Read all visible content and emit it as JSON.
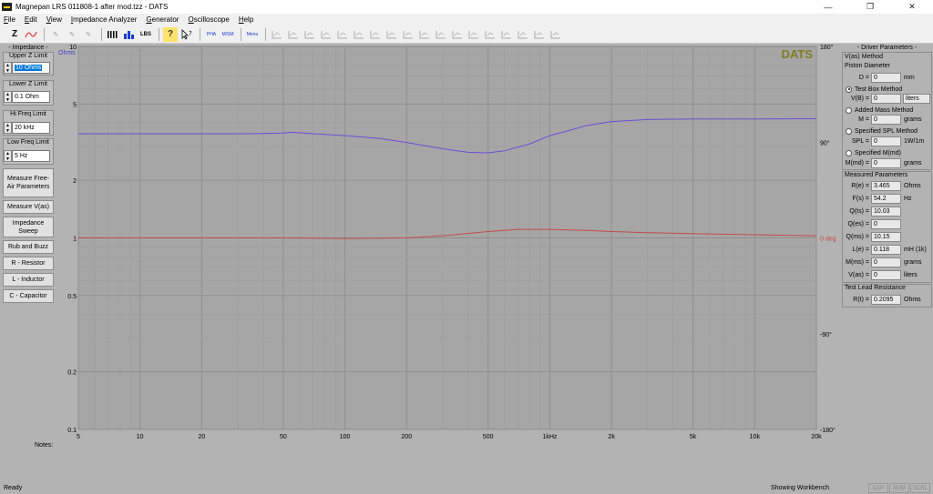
{
  "window": {
    "title": "Magnepan LRS 011808-1 after mod.tzz - DATS",
    "minimize": "—",
    "maximize": "❐",
    "close": "✕"
  },
  "menu": [
    {
      "label": "File",
      "key": "F"
    },
    {
      "label": "Edit",
      "key": "E"
    },
    {
      "label": "View",
      "key": "V"
    },
    {
      "label": "Impedance Analyzer",
      "key": "I"
    },
    {
      "label": "Generator",
      "key": "G"
    },
    {
      "label": "Oscilloscope",
      "key": "O"
    },
    {
      "label": "Help",
      "key": "H"
    }
  ],
  "toolbar": {
    "z_label": "Z",
    "help_label": "?",
    "lbs_label": "LBS",
    "pha_label": "PHA",
    "ms_label": "M/SM",
    "menu_label": "Menu"
  },
  "left_panel": {
    "section_title": "- Impedance -",
    "upper_label": "Upper Z Limit",
    "upper_value": "10 Ohms",
    "lower_label": "Lower Z Limit",
    "lower_value": "0.1 Ohm",
    "hi_label": "Hi Freq Limit",
    "hi_value": "20 kHz",
    "low_label": "Low Freq Limit",
    "low_value": "5 Hz",
    "buttons": [
      "Measure Free-Air Parameters",
      "Measure V(as)",
      "Impedance Sweep",
      "Rub and Buzz",
      "R - Resistor",
      "L - Inductor",
      "C - Capacitor"
    ]
  },
  "chart_data": {
    "type": "line",
    "watermark": "DATS",
    "y_unit": "Ohms",
    "x_scale": "log",
    "y_scale": "log",
    "xlim": [
      5,
      20000
    ],
    "ylim": [
      0.1,
      10
    ],
    "y2lim": [
      -180,
      180
    ],
    "x_tick_labels": [
      {
        "v": 5,
        "t": "5"
      },
      {
        "v": 10,
        "t": "10"
      },
      {
        "v": 20,
        "t": "20"
      },
      {
        "v": 50,
        "t": "50"
      },
      {
        "v": 100,
        "t": "100"
      },
      {
        "v": 200,
        "t": "200"
      },
      {
        "v": 500,
        "t": "500"
      },
      {
        "v": 1000,
        "t": "1kHz"
      },
      {
        "v": 2000,
        "t": "2k"
      },
      {
        "v": 5000,
        "t": "5k"
      },
      {
        "v": 10000,
        "t": "10k"
      },
      {
        "v": 20000,
        "t": "20k"
      }
    ],
    "y_tick_labels": [
      {
        "v": 10,
        "t": "10"
      },
      {
        "v": 5,
        "t": "5"
      },
      {
        "v": 2,
        "t": "2"
      },
      {
        "v": 1,
        "t": "1"
      },
      {
        "v": 0.5,
        "t": "0.5"
      },
      {
        "v": 0.2,
        "t": "0.2"
      },
      {
        "v": 0.1,
        "t": "0.1"
      }
    ],
    "y2_tick_labels": [
      {
        "v": 180,
        "t": "180°"
      },
      {
        "v": 90,
        "t": "90°"
      },
      {
        "v": 0,
        "t": "0 deg"
      },
      {
        "v": -90,
        "t": "-90°"
      },
      {
        "v": -180,
        "t": "-180°"
      }
    ],
    "grid": true,
    "series": [
      {
        "axis": "left",
        "color": "#6b4fd6",
        "x": [
          5,
          10,
          20,
          30,
          40,
          50,
          55,
          70,
          100,
          150,
          200,
          300,
          400,
          500,
          600,
          800,
          1000,
          1500,
          2000,
          3000,
          5000,
          10000,
          20000
        ],
        "y": [
          3.5,
          3.5,
          3.5,
          3.5,
          3.51,
          3.53,
          3.56,
          3.5,
          3.42,
          3.3,
          3.15,
          2.92,
          2.8,
          2.78,
          2.85,
          3.1,
          3.42,
          3.85,
          4.05,
          4.15,
          4.18,
          4.18,
          4.19
        ]
      },
      {
        "axis": "right",
        "color": "#c44a4a",
        "x": [
          5,
          50,
          100,
          200,
          300,
          500,
          700,
          1000,
          1500,
          2000,
          3000,
          5000,
          10000,
          20000
        ],
        "y": [
          0,
          0,
          -0.5,
          0,
          2,
          6,
          8,
          8,
          7,
          6,
          5,
          4,
          3,
          2
        ]
      }
    ]
  },
  "right_panel": {
    "title": "- Driver Parameters -",
    "vas_method": "V(as) Method",
    "piston": "Piston Diameter",
    "d_label": "D =",
    "d_value": "0",
    "d_unit": "mm",
    "test_box": "Test Box Method",
    "vb_label": "V(B) =",
    "vb_value": "0",
    "vb_unit": "liters",
    "added_mass": "Added Mass Method",
    "m_label": "M =",
    "m_value": "0",
    "m_unit": "grams",
    "spl_method": "Specified SPL Method",
    "spl_label": "SPL =",
    "spl_value": "0",
    "spl_unit": "1W/1m",
    "mmd_method": "Specified M(md)",
    "mmd_label": "M(md) =",
    "mmd_value": "0",
    "mmd_unit": "grams",
    "measured_title": "Measured Parameters",
    "params": [
      {
        "label": "R(e) =",
        "value": "3.465",
        "unit": "Ohms"
      },
      {
        "label": "F(s) =",
        "value": "54.2",
        "unit": "Hz"
      },
      {
        "label": "Q(ts) =",
        "value": "10.03",
        "unit": ""
      },
      {
        "label": "Q(es) =",
        "value": "0",
        "unit": ""
      },
      {
        "label": "Q(ms) =",
        "value": "10.15",
        "unit": ""
      },
      {
        "label": "L(e) =",
        "value": "0.118",
        "unit": "mH (1k)"
      },
      {
        "label": "M(ms) =",
        "value": "0",
        "unit": "grams"
      },
      {
        "label": "V(as) =",
        "value": "0",
        "unit": "liters"
      }
    ],
    "lead_title": "Test Lead Resistance",
    "rt_label": "R(t) =",
    "rt_value": "0.2095",
    "rt_unit": "Ohms"
  },
  "notes_label": "Notes:",
  "status": {
    "left": "Ready",
    "mid": "Showing Workbench",
    "cap": "CAP",
    "num": "NUM",
    "scrl": "SCRL"
  }
}
